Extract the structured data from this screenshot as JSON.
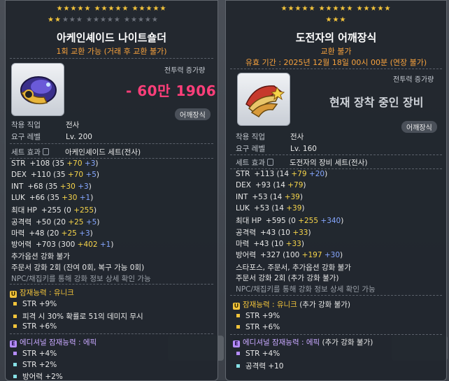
{
  "left": {
    "stars_row1": "★★★★★ ★★★★★ ★★★★★",
    "stars_row2_on": "★★",
    "stars_row2_off": "★★★ ★★★★★ ★★★★★",
    "name": "아케인셰이드 나이트숄더",
    "subtitle": "1회 교환 가능 (거래 후 교환 불가)",
    "cp_label": "전투력 증가량",
    "cp_value": "- 60만 1906",
    "type": "어깨장식",
    "req_job_label": "착용 직업",
    "req_job_value": "전사",
    "req_level_label": "요구 레벨",
    "req_level_value": "Lv. 200",
    "set_label": "세트 효과",
    "set_name": "아케인셰이드 세트(전사)",
    "stats": [
      {
        "k": "STR",
        "v": "+108",
        "base": "35",
        "y": "+70",
        "b": "+3"
      },
      {
        "k": "DEX",
        "v": "+110",
        "base": "35",
        "y": "+70",
        "b": "+5"
      },
      {
        "k": "INT",
        "v": "+68",
        "base": "35",
        "y": "+30",
        "b": "+3"
      },
      {
        "k": "LUK",
        "v": "+66",
        "base": "35",
        "y": "+30",
        "b": "+1"
      },
      {
        "k": "최대 HP",
        "v": "+255",
        "base": "0",
        "y": "+255",
        "b": ""
      },
      {
        "k": "공격력",
        "v": "+50",
        "base": "20",
        "y": "+25",
        "b": "+5"
      },
      {
        "k": "마력",
        "v": "+48",
        "base": "20",
        "y": "+25",
        "b": "+3"
      },
      {
        "k": "방어력",
        "v": "+703",
        "base": "300",
        "y": "+402",
        "b": "+1"
      }
    ],
    "notes": [
      "추가옵션 강화 불가",
      "주문서 강화 2회 (잔여 0회, 복구 가능 0회)",
      "NPC/채집키를 통해 강화 정보 상세 확인 가능"
    ],
    "potential_title": "잠재능력 : 유니크",
    "potential_lines": [
      "STR +9%",
      "피격 시 30% 확률로 51의 데미지 무시",
      "STR +6%"
    ],
    "additional_title": "에디셔널 잠재능력 : 에픽",
    "additional_lines": [
      "STR +4%",
      "STR +2%",
      "방어력 +2%"
    ]
  },
  "right": {
    "stars_row1": "★★★★★ ★★★★★ ★★★★★",
    "stars_row2_on": "★★★",
    "name": "도전자의 어깨장식",
    "subtitle": "교환 불가",
    "expiry": "유효 기간 : 2025년 12월 18일 00시 00분 (연장 불가)",
    "cp_label": "전투력 증가량",
    "cp_equipped": "현재 장착 중인 장비",
    "type": "어깨장식",
    "req_job_label": "착용 직업",
    "req_job_value": "전사",
    "req_level_label": "요구 레벨",
    "req_level_value": "Lv. 160",
    "set_label": "세트 효과",
    "set_name": "도전자의 장비 세트(전사)",
    "stats": [
      {
        "k": "STR",
        "v": "+113",
        "base": "14",
        "y": "+79",
        "b": "+20"
      },
      {
        "k": "DEX",
        "v": "+93",
        "base": "14",
        "y": "+79",
        "b": ""
      },
      {
        "k": "INT",
        "v": "+53",
        "base": "14",
        "y": "+39",
        "b": ""
      },
      {
        "k": "LUK",
        "v": "+53",
        "base": "14",
        "y": "+39",
        "b": ""
      },
      {
        "k": "최대 HP",
        "v": "+595",
        "base": "0",
        "y": "+255",
        "b": "+340"
      },
      {
        "k": "공격력",
        "v": "+43",
        "base": "10",
        "y": "+33",
        "b": ""
      },
      {
        "k": "마력",
        "v": "+43",
        "base": "10",
        "y": "+33",
        "b": ""
      },
      {
        "k": "방어력",
        "v": "+327",
        "base": "100",
        "y": "+197",
        "b": "+30"
      }
    ],
    "notes": [
      "스타포스, 주문서, 추가옵션 강화 불가",
      "주문서 강화 2회 (추가 강화 불가)",
      "NPC/채집키를 통해 강화 정보 상세 확인 가능"
    ],
    "potential_title": "잠재능력 : 유니크",
    "potential_extra": "(추가 강화 불가)",
    "potential_lines": [
      "STR +9%",
      "STR +6%"
    ],
    "additional_title": "에디셔널 잠재능력 : 에픽",
    "additional_extra": "(추가 강화 불가)",
    "additional_lines": [
      "STR +4%",
      "공격력 +10"
    ]
  }
}
